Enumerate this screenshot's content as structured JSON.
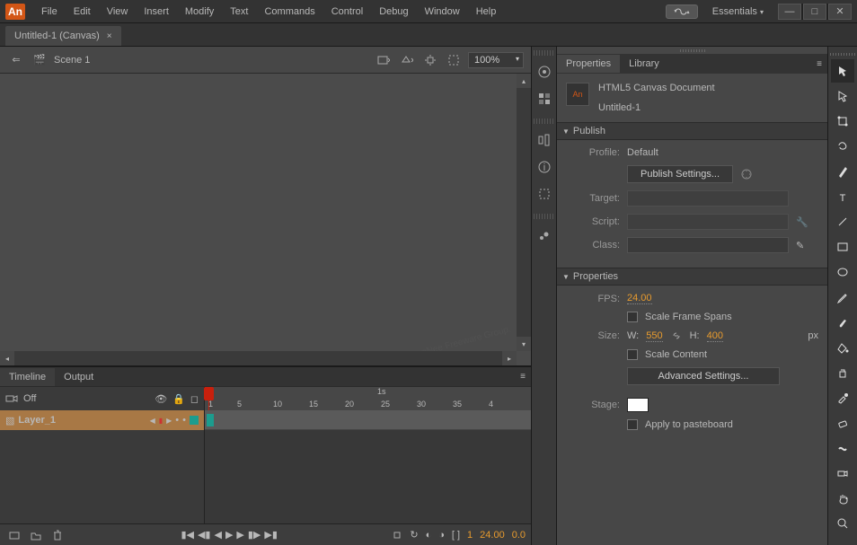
{
  "app": {
    "logo": "An"
  },
  "menu": {
    "file": "File",
    "edit": "Edit",
    "view": "View",
    "insert": "Insert",
    "modify": "Modify",
    "text": "Text",
    "commands": "Commands",
    "control": "Control",
    "debug": "Debug",
    "window": "Window",
    "help": "Help"
  },
  "workspace": {
    "label": "Essentials"
  },
  "document": {
    "tab": "Untitled-1 (Canvas)",
    "close": "×"
  },
  "stage": {
    "back": "⇐",
    "scene_icon": "🎬",
    "scene": "Scene 1",
    "zoom": "100%",
    "watermark": "AppNee Freeware Group."
  },
  "timeline": {
    "tab_timeline": "Timeline",
    "tab_output": "Output",
    "camera": "Off",
    "layer": "Layer_1",
    "ticks": [
      "1",
      "5",
      "10",
      "15",
      "20",
      "25",
      "30",
      "35",
      "4"
    ],
    "ts_label": "1s",
    "frame": "1",
    "fps": "24.00",
    "elapsed": "0.0"
  },
  "properties": {
    "tab_props": "Properties",
    "tab_library": "Library",
    "doc_type": "HTML5 Canvas Document",
    "doc_name": "Untitled-1",
    "section_publish": "Publish",
    "profile_label": "Profile:",
    "profile_value": "Default",
    "publish_settings_btn": "Publish Settings...",
    "target_label": "Target:",
    "script_label": "Script:",
    "class_label": "Class:",
    "section_props": "Properties",
    "fps_label": "FPS:",
    "fps_value": "24.00",
    "scale_spans": "Scale Frame Spans",
    "size_label": "Size:",
    "w_label": "W:",
    "w_value": "550",
    "h_label": "H:",
    "h_value": "400",
    "px": "px",
    "scale_content": "Scale Content",
    "advanced_btn": "Advanced Settings...",
    "stage_label": "Stage:",
    "apply_pasteboard": "Apply to pasteboard"
  }
}
